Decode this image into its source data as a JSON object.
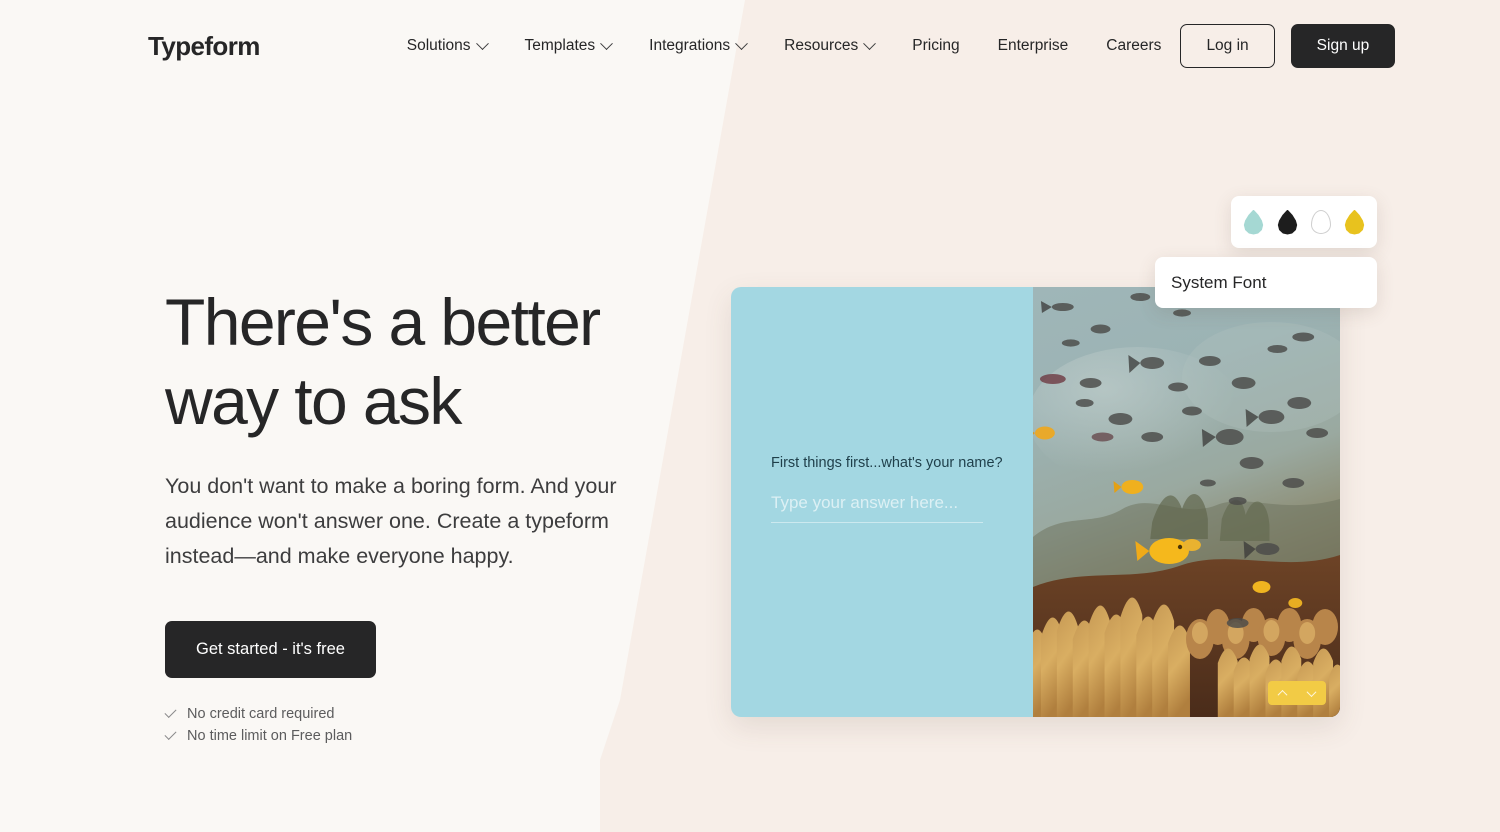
{
  "header": {
    "logo": "Typeform",
    "nav": [
      {
        "label": "Solutions",
        "has_chevron": true,
        "icon": "chevron-down-icon"
      },
      {
        "label": "Templates",
        "has_chevron": true,
        "icon": "chevron-down-icon"
      },
      {
        "label": "Integrations",
        "has_chevron": true,
        "icon": "chevron-down-icon"
      },
      {
        "label": "Resources",
        "has_chevron": true,
        "icon": "chevron-down-icon"
      },
      {
        "label": "Pricing",
        "has_chevron": false,
        "icon": ""
      },
      {
        "label": "Enterprise",
        "has_chevron": false,
        "icon": ""
      },
      {
        "label": "Careers",
        "has_chevron": false,
        "icon": ""
      }
    ],
    "login_label": "Log in",
    "signup_label": "Sign up"
  },
  "hero": {
    "title_line1": "There's a better",
    "title_line2": "way to ask",
    "subtitle": "You don't want to make a boring form. And your audience won't answer one. Create a typeform instead—and make everyone happy.",
    "cta_label": "Get started - it's free",
    "perks": [
      {
        "icon": "check-icon",
        "label": "No credit card required"
      },
      {
        "icon": "check-icon",
        "label": "No time limit on Free plan"
      }
    ]
  },
  "preview": {
    "question": "First things first...what's your name?",
    "answer_placeholder": "Type your answer here...",
    "pane_color": "#a3d7e2",
    "nav_up_icon": "chevron-up-icon",
    "nav_down_icon": "chevron-down-icon",
    "nav_color": "#f2cb45",
    "photo_alt": "underwater-coral-reef-photo"
  },
  "swatch_card": {
    "name": "color-swatch-card",
    "swatches": [
      {
        "name": "swatch-teal",
        "icon": "droplet-icon",
        "color": "#a5d8d3",
        "outlined": false
      },
      {
        "name": "swatch-black",
        "icon": "droplet-icon",
        "color": "#1d1d1d",
        "outlined": false
      },
      {
        "name": "swatch-white",
        "icon": "droplet-icon",
        "color": "#ffffff",
        "outlined": true
      },
      {
        "name": "swatch-yellow",
        "icon": "droplet-icon",
        "color": "#e8c21e",
        "outlined": false
      }
    ]
  },
  "font_card": {
    "name": "font-picker-card",
    "label": "System Font"
  },
  "theme": {
    "background_left": "#faf8f5",
    "background_right": "#f7eee8",
    "text_dark": "#262627",
    "accent_dark": "#262627"
  }
}
